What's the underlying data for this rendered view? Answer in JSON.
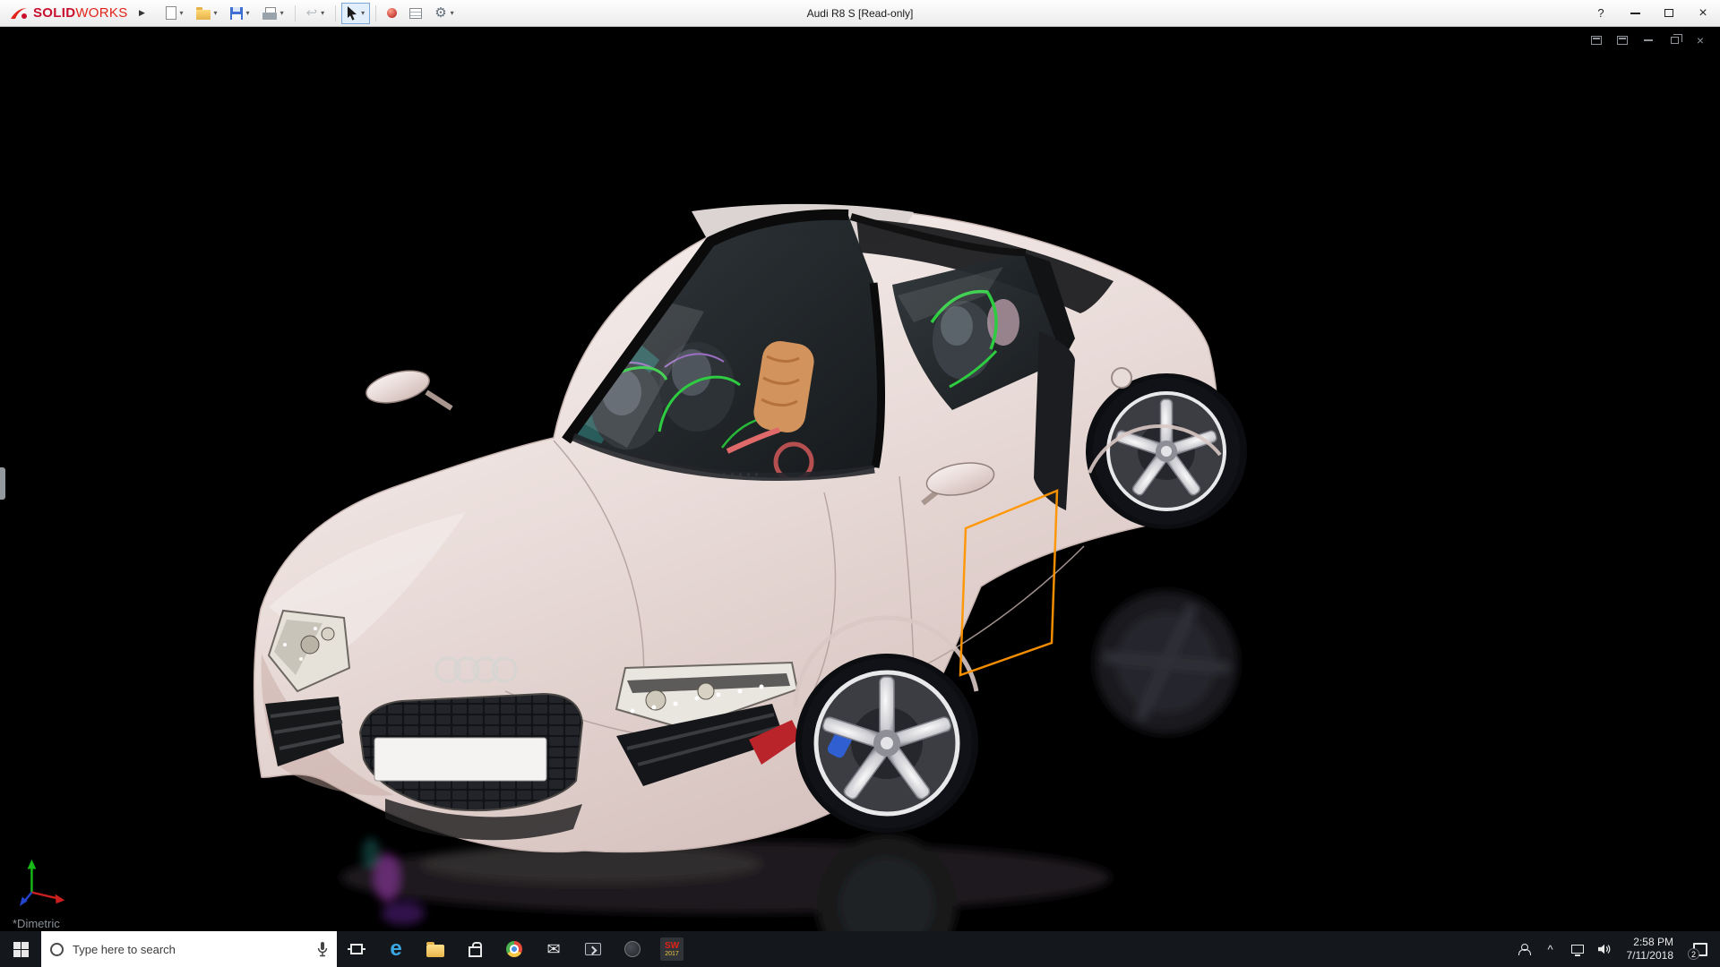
{
  "titlebar": {
    "logo_solid": "SOLID",
    "logo_works": "WORKS",
    "title": "Audi R8 S [Read-only]",
    "help_glyph": "?"
  },
  "glyphs": {
    "flyout": "▶",
    "caret": "▾",
    "gear": "⚙",
    "undo": "↩",
    "mail": "✉",
    "close": "×",
    "chevron_up": "^",
    "edge": "e"
  },
  "viewport": {
    "view_label": "*Dimetric"
  },
  "taskbar": {
    "search_placeholder": "Type here to search",
    "solidworks_label": "SW",
    "solidworks_year": "2017",
    "clock_time": "2:58 PM",
    "clock_date": "7/11/2018",
    "action_badge": "2"
  }
}
